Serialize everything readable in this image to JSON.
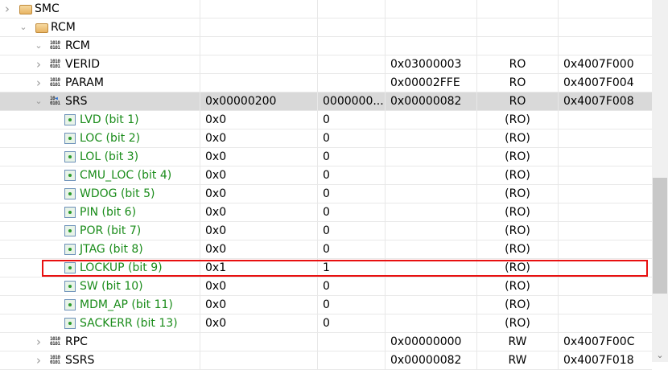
{
  "rows": [
    {
      "level": 0,
      "icon": "folder-icon",
      "expander": "collapsed",
      "name": "SMC",
      "cols": [
        "",
        "",
        "",
        "",
        ""
      ]
    },
    {
      "level": 1,
      "icon": "folder-icon",
      "expander": "expanded",
      "name": "RCM",
      "cols": [
        "",
        "",
        "",
        "",
        ""
      ]
    },
    {
      "level": 2,
      "icon": "peripheral-icon",
      "expander": "expanded",
      "name": "RCM",
      "cols": [
        "",
        "",
        "",
        "",
        ""
      ]
    },
    {
      "level": 3,
      "icon": "register-icon",
      "expander": "collapsed",
      "name": "VERID",
      "cols": [
        "",
        "",
        "0x03000003",
        "RO",
        "0x4007F000"
      ]
    },
    {
      "level": 3,
      "icon": "register-icon",
      "expander": "collapsed",
      "name": "PARAM",
      "cols": [
        "",
        "",
        "0x00002FFE",
        "RO",
        "0x4007F004"
      ]
    },
    {
      "level": 3,
      "icon": "register-changed-icon",
      "expander": "expanded",
      "name": "SRS",
      "selected": true,
      "cols": [
        "0x00000200",
        "0000000...",
        "0x00000082",
        "RO",
        "0x4007F008"
      ]
    },
    {
      "level": 4,
      "icon": "field-icon",
      "name": "LVD (bit 1)",
      "cols": [
        "0x0",
        "0",
        "",
        "(RO)",
        ""
      ]
    },
    {
      "level": 4,
      "icon": "field-icon",
      "name": "LOC (bit 2)",
      "cols": [
        "0x0",
        "0",
        "",
        "(RO)",
        ""
      ]
    },
    {
      "level": 4,
      "icon": "field-icon",
      "name": "LOL (bit 3)",
      "cols": [
        "0x0",
        "0",
        "",
        "(RO)",
        ""
      ]
    },
    {
      "level": 4,
      "icon": "field-icon",
      "name": "CMU_LOC (bit 4)",
      "cols": [
        "0x0",
        "0",
        "",
        "(RO)",
        ""
      ]
    },
    {
      "level": 4,
      "icon": "field-icon",
      "name": "WDOG (bit 5)",
      "cols": [
        "0x0",
        "0",
        "",
        "(RO)",
        ""
      ]
    },
    {
      "level": 4,
      "icon": "field-icon",
      "name": "PIN (bit 6)",
      "cols": [
        "0x0",
        "0",
        "",
        "(RO)",
        ""
      ]
    },
    {
      "level": 4,
      "icon": "field-icon",
      "name": "POR (bit 7)",
      "cols": [
        "0x0",
        "0",
        "",
        "(RO)",
        ""
      ]
    },
    {
      "level": 4,
      "icon": "field-icon",
      "name": "JTAG (bit 8)",
      "cols": [
        "0x0",
        "0",
        "",
        "(RO)",
        ""
      ]
    },
    {
      "level": 4,
      "icon": "field-icon",
      "name": "LOCKUP (bit 9)",
      "highlighted": true,
      "cols": [
        "0x1",
        "1",
        "",
        "(RO)",
        ""
      ]
    },
    {
      "level": 4,
      "icon": "field-icon",
      "name": "SW (bit 10)",
      "cols": [
        "0x0",
        "0",
        "",
        "(RO)",
        ""
      ]
    },
    {
      "level": 4,
      "icon": "field-icon",
      "name": "MDM_AP (bit 11)",
      "cols": [
        "0x0",
        "0",
        "",
        "(RO)",
        ""
      ]
    },
    {
      "level": 4,
      "icon": "field-icon",
      "name": "SACKERR (bit 13)",
      "cols": [
        "0x0",
        "0",
        "",
        "(RO)",
        ""
      ]
    },
    {
      "level": 3,
      "icon": "register-icon",
      "expander": "collapsed",
      "name": "RPC",
      "cols": [
        "",
        "",
        "0x00000000",
        "RW",
        "0x4007F00C"
      ]
    },
    {
      "level": 3,
      "icon": "register-icon",
      "expander": "collapsed",
      "name": "SSRS",
      "cols": [
        "",
        "",
        "0x00000082",
        "RW",
        "0x4007F018"
      ]
    }
  ],
  "scrollbar": {
    "position_fraction": 0.49,
    "visible_fraction": 0.32
  },
  "colors": {
    "field_text": "#1a8c1a",
    "highlight_box": "#e81010",
    "selected_row": "#d9d9d9"
  }
}
